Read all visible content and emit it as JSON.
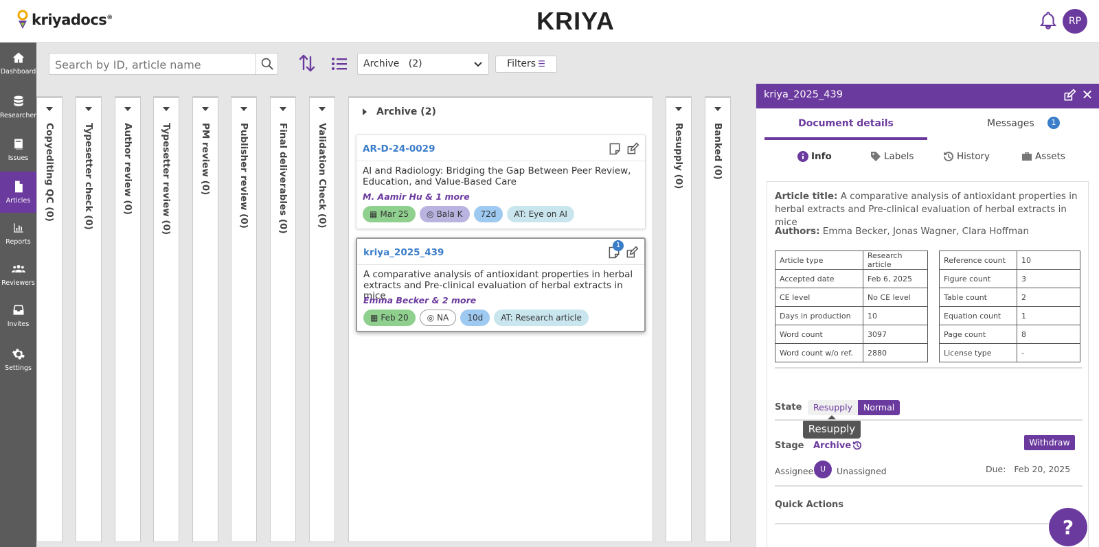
{
  "header": {
    "logo_text": "kriyadocs",
    "logo_mark": "®",
    "brand": "KRIYA",
    "user_initials": "RP"
  },
  "sidebar": {
    "items": [
      {
        "label": "Dashboard",
        "icon": "home-icon"
      },
      {
        "label": "Researcher",
        "icon": "database-icon"
      },
      {
        "label": "Issues",
        "icon": "book-icon"
      },
      {
        "label": "Articles",
        "icon": "document-icon",
        "active": true
      },
      {
        "label": "Reports",
        "icon": "chart-icon"
      },
      {
        "label": "Reviewers",
        "icon": "people-icon"
      },
      {
        "label": "Invites",
        "icon": "inbox-icon"
      },
      {
        "label": "Settings",
        "icon": "gear-icon"
      }
    ]
  },
  "toolbar": {
    "search_placeholder": "Search by ID, article name",
    "select_value": "Archive   (2)",
    "filters_label": "Filters"
  },
  "columns": [
    "Copyediting QC (0)",
    "Typesetter check (0)",
    "Author review (0)",
    "Typesetter review (0)",
    "PM review (0)",
    "Publisher review (0)",
    "Final deliverables (0)",
    "Validation Check (0)",
    "Resupply (0)",
    "Banked (0)"
  ],
  "archive": {
    "title": "Archive (2)",
    "cards": [
      {
        "id": "AR-D-24-0029",
        "title": "AI and Radiology: Bridging the Gap Between Peer Review, Education, and Value-Based Care",
        "authors": "M. Aamir Hu & 1 more",
        "date": "Mar 25",
        "user": "Bala K",
        "days": "72d",
        "type": "AT: Eye on AI"
      },
      {
        "id": "kriya_2025_439",
        "title": "A comparative analysis of antioxidant properties in herbal extracts and Pre-clinical evaluation of herbal extracts in mice",
        "authors": "Emma Becker & 2 more",
        "date": "Feb 20",
        "user": "NA",
        "days": "10d",
        "type": "AT: Research article",
        "notification_count": "1"
      }
    ]
  },
  "panel": {
    "title": "kriya_2025_439",
    "tabs": {
      "document": "Document details",
      "messages": "Messages",
      "messages_count": "1"
    },
    "subtabs": [
      "Info",
      "Labels",
      "History",
      "Assets"
    ],
    "article_title_label": "Article title:",
    "article_title": "A comparative analysis of antioxidant properties in herbal extracts and Pre-clinical evaluation of herbal extracts in mice",
    "authors_label": "Authors:",
    "authors": "Emma Becker, Jonas Wagner, Clara Hoffman",
    "meta_left": [
      [
        "Article type",
        "Research article"
      ],
      [
        "Accepted date",
        "Feb 6, 2025"
      ],
      [
        "CE level",
        "No CE level"
      ],
      [
        "Days in production",
        "10"
      ],
      [
        "Word count",
        "3097"
      ],
      [
        "Word count w/o ref.",
        "2880"
      ]
    ],
    "meta_right": [
      [
        "Reference count",
        "10"
      ],
      [
        "Figure count",
        "3"
      ],
      [
        "Table count",
        "2"
      ],
      [
        "Equation count",
        "1"
      ],
      [
        "Page count",
        "8"
      ],
      [
        "License type",
        "-"
      ]
    ],
    "state_label": "State",
    "state_options": [
      "Resupply",
      "Normal"
    ],
    "tooltip": "Resupply",
    "stage_label": "Stage",
    "stage_value": "Archive",
    "withdraw_label": "Withdraw",
    "assignee_label": "Assignee:",
    "assignee_initial": "U",
    "assignee_value": "Unassigned",
    "due_label": "Due:",
    "due_value": "Feb 20, 2025",
    "quick_actions": "Quick Actions",
    "help": "?"
  },
  "colors": {
    "accent": "#6b3a9e",
    "link": "#3b7dc8",
    "sidebar": "#5b5b5b"
  }
}
